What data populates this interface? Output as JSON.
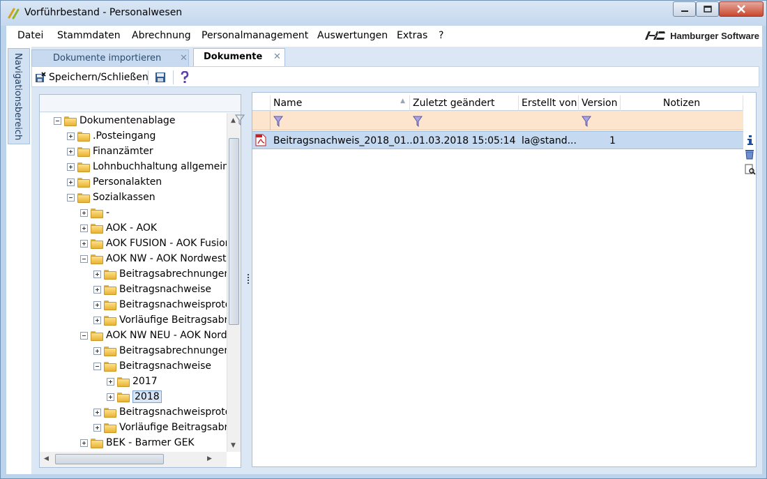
{
  "window": {
    "title": "Vorführbestand - Personalwesen"
  },
  "menu": {
    "items": [
      "Datei",
      "Stammdaten",
      "Abrechnung",
      "Personalmanagement",
      "Auswertungen",
      "Extras",
      "?"
    ],
    "brand": "Hamburger Software"
  },
  "nav": {
    "label": "Navigationsbereich"
  },
  "tabs": [
    {
      "label": "Dokumente importieren",
      "active": false
    },
    {
      "label": "Dokumente",
      "active": true
    }
  ],
  "toolbar": {
    "save_close_label": "Speichern/Schließen"
  },
  "tree": {
    "items": [
      {
        "label": "Dokumentenablage",
        "level": 0,
        "expanded": true
      },
      {
        "label": ".Posteingang",
        "level": 1,
        "expanded": false
      },
      {
        "label": "Finanzämter",
        "level": 1,
        "expanded": false
      },
      {
        "label": "Lohnbuchhaltung allgemein",
        "level": 1,
        "expanded": false
      },
      {
        "label": "Personalakten",
        "level": 1,
        "expanded": false
      },
      {
        "label": "Sozialkassen",
        "level": 1,
        "expanded": true
      },
      {
        "label": "-",
        "level": 2,
        "expanded": false
      },
      {
        "label": "AOK - AOK",
        "level": 2,
        "expanded": false
      },
      {
        "label": "AOK FUSION - AOK Fusion",
        "level": 2,
        "expanded": false
      },
      {
        "label": "AOK NW - AOK Nordwest",
        "level": 2,
        "expanded": true
      },
      {
        "label": "Beitragsabrechnungen",
        "level": 3,
        "expanded": false
      },
      {
        "label": "Beitragsnachweise",
        "level": 3,
        "expanded": false
      },
      {
        "label": "Beitragsnachweisprotok",
        "level": 3,
        "expanded": false
      },
      {
        "label": "Vorläufige Beitragsabre",
        "level": 3,
        "expanded": false
      },
      {
        "label": "AOK NW NEU - AOK Nord",
        "level": 2,
        "expanded": true
      },
      {
        "label": "Beitragsabrechnungen",
        "level": 3,
        "expanded": false
      },
      {
        "label": "Beitragsnachweise",
        "level": 3,
        "expanded": true
      },
      {
        "label": "2017",
        "level": 4,
        "expanded": false
      },
      {
        "label": "2018",
        "level": 4,
        "expanded": false,
        "selected": true
      },
      {
        "label": "Beitragsnachweisprotok",
        "level": 3,
        "expanded": false
      },
      {
        "label": "Vorläufige Beitragsabre",
        "level": 3,
        "expanded": false
      },
      {
        "label": "BEK - Barmer GEK",
        "level": 2,
        "expanded": false
      }
    ]
  },
  "grid": {
    "columns": [
      "Name",
      "Zuletzt geändert",
      "Erstellt von",
      "Version",
      "Notizen"
    ],
    "rows": [
      {
        "name": "Beitragsnachweis_2018_01...",
        "modified": "01.03.2018 15:05:14",
        "created_by": "la@stand...",
        "version": "1",
        "notes": ""
      }
    ]
  },
  "colors": {
    "selection": "#c5d9f1",
    "filter_row": "#fde5cd",
    "frame": "#bcd3ec"
  }
}
